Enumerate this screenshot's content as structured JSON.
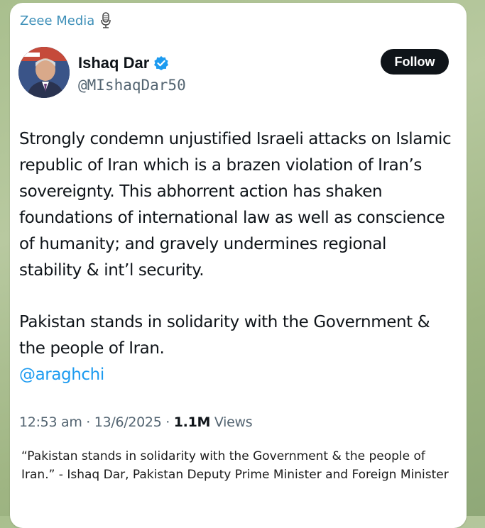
{
  "channel": {
    "name": "Zeee Media"
  },
  "tweet": {
    "author_name": "Ishaq Dar",
    "handle": "@MIshaqDar50",
    "follow_label": "Follow",
    "paragraph1": "Strongly condemn unjustified Israeli attacks on Islamic republic of Iran which is a brazen violation of Iran’s sovereignty. This abhorrent action has shaken foundations of international law as well as conscience of humanity; and gravely undermines regional stability & int’l security.",
    "paragraph2": "Pakistan stands in solidarity with the Government & the people of Iran.",
    "mention": "@araghchi",
    "time": "12:53 am",
    "date": "13/6/2025",
    "views_count": "1.1M",
    "views_label": "Views"
  },
  "caption": "“Pakistan stands in solidarity with the Government & the people of Iran.” - Ishaq Dar, Pakistan Deputy Prime Minister and Foreign Minister",
  "colors": {
    "accent": "#1d9bf0",
    "channel": "#3d8fb8",
    "button": "#0f1419"
  },
  "icons": [
    "microphone-icon",
    "verified-badge-icon"
  ]
}
